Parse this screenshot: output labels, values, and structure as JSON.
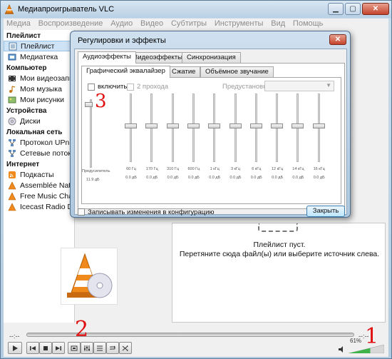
{
  "window": {
    "title": "Медиапроигрыватель VLC",
    "min_glyph": "▁",
    "max_glyph": "▢",
    "close_glyph": "✕"
  },
  "menu": [
    "Медиа",
    "Воспроизведение",
    "Аудио",
    "Видео",
    "Субтитры",
    "Инструменты",
    "Вид",
    "Помощь"
  ],
  "sidebar": {
    "sections": [
      {
        "title": "Плейлист",
        "items": [
          {
            "label": "Плейлист",
            "icon": "playlist-icon",
            "selected": true
          },
          {
            "label": "Медиатека",
            "icon": "library-icon"
          }
        ]
      },
      {
        "title": "Компьютер",
        "items": [
          {
            "label": "Мои видеозаписи",
            "icon": "video-icon"
          },
          {
            "label": "Моя музыка",
            "icon": "music-icon"
          },
          {
            "label": "Мои рисунки",
            "icon": "pictures-icon"
          }
        ]
      },
      {
        "title": "Устройства",
        "items": [
          {
            "label": "Диски",
            "icon": "disc-icon"
          }
        ]
      },
      {
        "title": "Локальная сеть",
        "items": [
          {
            "label": "Протокол UPnP",
            "icon": "network-icon"
          },
          {
            "label": "Сетевые потоки (SAP)",
            "icon": "network-icon"
          }
        ]
      },
      {
        "title": "Интернет",
        "items": [
          {
            "label": "Подкасты",
            "icon": "podcast-icon"
          },
          {
            "label": "Assemblée Nationale",
            "icon": "web-icon"
          },
          {
            "label": "Free Music Charts",
            "icon": "web-icon"
          },
          {
            "label": "Icecast Radio Directory",
            "icon": "web-icon"
          }
        ]
      }
    ]
  },
  "playlist": {
    "empty_line1": "Плейлист пуст.",
    "empty_line2": "Перетяните сюда файл(ы) или выберите источник слева."
  },
  "controls": {
    "time_elapsed": "--:--",
    "time_total": "--:--",
    "volume": "61%",
    "volume_fraction": 0.61
  },
  "annotations": [
    "1",
    "2",
    "3"
  ],
  "dialog": {
    "title": "Регулировки и эффекты",
    "close_glyph": "✕",
    "tabs": [
      "Аудиоэффекты",
      "Видеоэффекты",
      "Синхронизация"
    ],
    "subtabs": [
      "Графический эквалайзер",
      "Сжатие",
      "Объёмное звучание"
    ],
    "enable_label": "включить",
    "two_pass_label": "2 прохода",
    "preset_label": "Предустановка",
    "preset_value": "",
    "preamp_label": "Предусилитель",
    "preamp_value": "11.9 дБ",
    "bands": [
      {
        "freq": "60 Гц",
        "db": "0.0 дБ"
      },
      {
        "freq": "170 Гц",
        "db": "0.0 дБ"
      },
      {
        "freq": "310 Гц",
        "db": "0.0 дБ"
      },
      {
        "freq": "600 Гц",
        "db": "0.0 дБ"
      },
      {
        "freq": "1 кГц",
        "db": "0.0 дБ"
      },
      {
        "freq": "3 кГц",
        "db": "0.0 дБ"
      },
      {
        "freq": "6 кГц",
        "db": "0.0 дБ"
      },
      {
        "freq": "12 кГц",
        "db": "0.0 дБ"
      },
      {
        "freq": "14 кГц",
        "db": "0.0 дБ"
      },
      {
        "freq": "16 кГц",
        "db": "0.0 дБ"
      }
    ],
    "save_label": "Записывать изменения в конфигурацию",
    "close_button": "Закрыть"
  }
}
